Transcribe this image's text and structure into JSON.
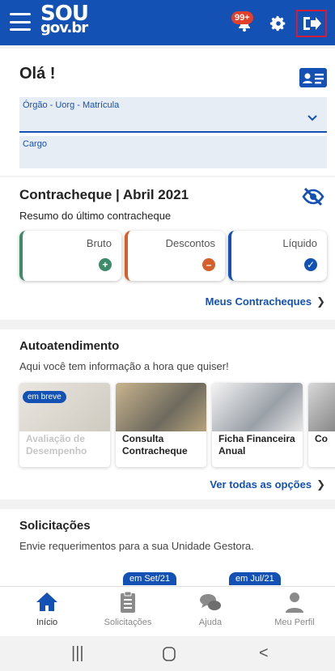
{
  "header": {
    "logo_line1": "SOU",
    "logo_line2": "gov.br",
    "notification_badge": "99+"
  },
  "greeting": {
    "title": "Olá          !",
    "field1_label": "Órgão - Uorg - Matrícula",
    "field2_label": "Cargo"
  },
  "paycheck": {
    "title": "Contracheque | Abril 2021",
    "subtitle": "Resumo do último contracheque",
    "bruto_label": "Bruto",
    "descontos_label": "Descontos",
    "liquido_label": "Líquido",
    "link": "Meus Contracheques"
  },
  "self_service": {
    "title": "Autoatendimento",
    "subtitle": "Aqui você tem informação a hora que quiser!",
    "tiles": [
      {
        "label": "Avaliação de Desempenho",
        "badge": "em breve"
      },
      {
        "label": "Consulta Contracheque"
      },
      {
        "label": "Ficha Financeira Anual"
      },
      {
        "label": "Co"
      }
    ],
    "link": "Ver todas as opções"
  },
  "requests": {
    "title": "Solicitações",
    "subtitle": "Envie requerimentos para a sua Unidade Gestora.",
    "pill1": "em Set/21",
    "pill2": "em Jul/21"
  },
  "bottom_nav": {
    "items": [
      {
        "label": "Início"
      },
      {
        "label": "Solicitações"
      },
      {
        "label": "Ajuda"
      },
      {
        "label": "Meu Perfil"
      }
    ]
  },
  "colors": {
    "brand": "#1351b4",
    "alert": "#e1402c",
    "bruto": "#3d8b6a",
    "descontos": "#d4602b"
  }
}
